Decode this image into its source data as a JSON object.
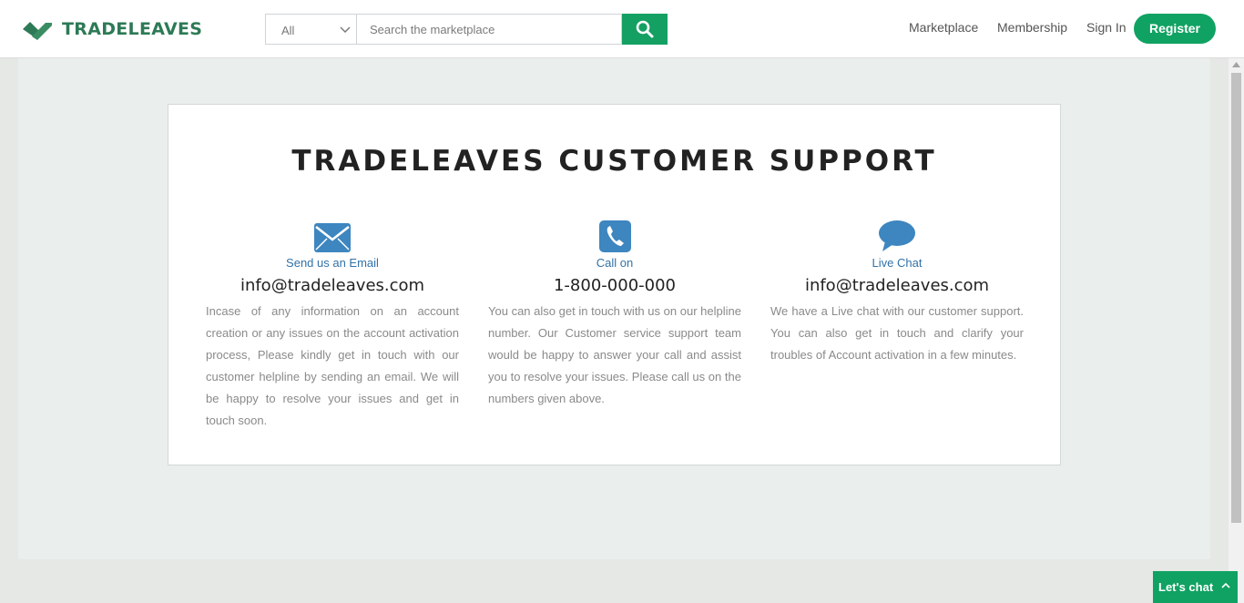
{
  "brand": {
    "name": "TRADELEAVES"
  },
  "search": {
    "category": "All",
    "placeholder": "Search the marketplace"
  },
  "nav": {
    "marketplace": "Marketplace",
    "membership": "Membership",
    "sign_in": "Sign In",
    "register": "Register"
  },
  "support": {
    "title": "TRADELEAVES CUSTOMER SUPPORT",
    "columns": [
      {
        "icon": "envelope-icon",
        "label": "Send us an Email",
        "value": "info@tradeleaves.com",
        "text": "Incase of any information on an account creation or any issues on the account activation process, Please kindly get in touch with our customer helpline by sending an email. We will be happy to resolve your issues and get in touch soon."
      },
      {
        "icon": "phone-icon",
        "label": "Call on",
        "value": "1-800-000-000",
        "text": "You can also get in touch with us on our helpline number. Our Customer service support team would be happy to answer your call and assist you to resolve your issues. Please call us on the numbers given above."
      },
      {
        "icon": "chat-bubble-icon",
        "label": "Live Chat",
        "value": "info@tradeleaves.com",
        "text": "We have a Live chat with our customer support. You can also get in touch and clarify your troubles of Account activation in a few minutes."
      }
    ]
  },
  "chat_widget": {
    "label": "Let's chat"
  },
  "colors": {
    "brand_green": "#10a262",
    "icon_blue": "#3d86c0",
    "label_blue": "#3172a8"
  }
}
